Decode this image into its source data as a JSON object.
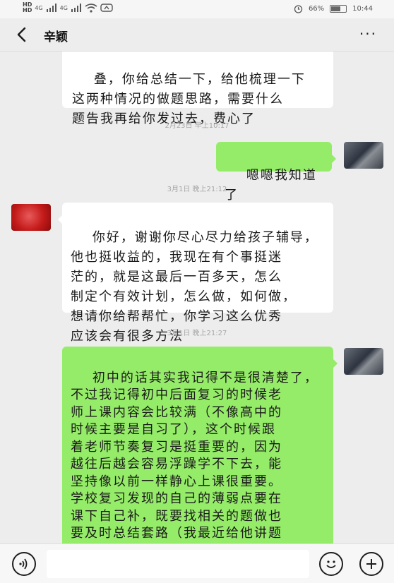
{
  "status_bar": {
    "sim1_label": "HD",
    "sim2_label": "HD",
    "network1": "4G",
    "network2": "4G",
    "battery_percent": "66%",
    "battery_level": 0.66,
    "time": "10:44"
  },
  "header": {
    "title": "辛颖",
    "more_label": "···"
  },
  "messages": [
    {
      "side": "in",
      "text": "叠，你给总结一下，给他梳理一下\n这两种情况的做题思路，需要什么\n题告我再给你发过去，费心了"
    },
    {
      "timestamp": "2月23日 早上10:17"
    },
    {
      "side": "out",
      "text": "嗯嗯我知道了"
    },
    {
      "timestamp": "3月1日 晚上21:12"
    },
    {
      "side": "in",
      "text": "你好，谢谢你尽心尽力给孩子辅导，\n他也挺收益的，我现在有个事挺迷\n茫的，就是这最后一百多天，怎么\n制定个有效计划，怎么做，如何做，\n想请你给帮帮忙，你学习这么优秀\n应该会有很多方法"
    },
    {
      "timestamp": "3月1日 晚上21:27"
    },
    {
      "side": "out",
      "text": "初中的话其实我记得不是很清楚了，\n不过我记得初中后面复习的时候老\n师上课内容会比较满（不像高中的\n时候主要是自习了），这个时候跟\n着老师节奏复习是挺重要的，因为\n越往后越会容易浮躁学不下去，能\n坚持像以前一样静心上课很重要。\n学校复习发现的自己的薄弱点要在\n课下自己补，既要找相关的题做也\n要及时总结套路（我最近给他讲题\n也穿插了这样的想法，比如他的三\n角函数好像有点不熟练），这方面"
    }
  ],
  "input_bar": {
    "voice_icon": "voice-icon",
    "emoji_icon": "emoji-icon",
    "plus_icon": "plus-icon"
  }
}
